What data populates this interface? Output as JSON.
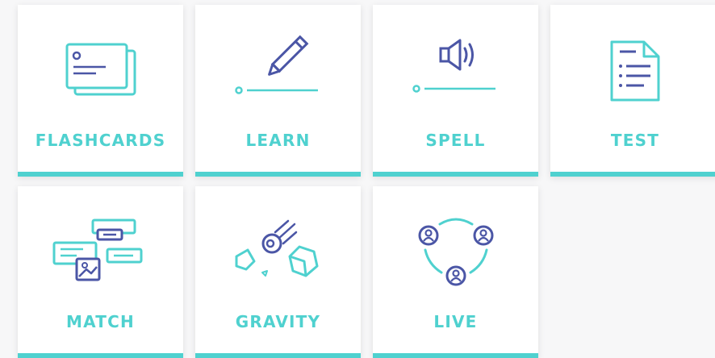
{
  "colors": {
    "accent": "#4fd1cf",
    "icon_blue": "#4b56a6",
    "card_bg": "#ffffff"
  },
  "modes": [
    {
      "label": "FLASHCARDS",
      "icon": "flashcards-icon"
    },
    {
      "label": "LEARN",
      "icon": "pencil-icon"
    },
    {
      "label": "SPELL",
      "icon": "speaker-icon"
    },
    {
      "label": "TEST",
      "icon": "document-checklist-icon"
    },
    {
      "label": "MATCH",
      "icon": "match-cards-icon"
    },
    {
      "label": "GRAVITY",
      "icon": "asteroid-icon"
    },
    {
      "label": "LIVE",
      "icon": "team-icon"
    }
  ]
}
